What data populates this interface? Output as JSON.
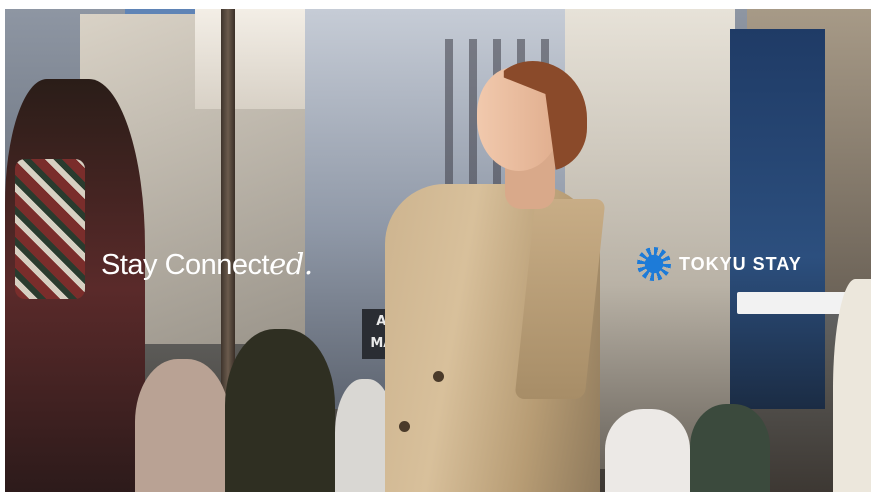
{
  "ad": {
    "tagline_main": "Stay Connect",
    "tagline_suffix": "ed.",
    "brand_name": "TOKYU STAY",
    "brand_color": "#1d7bd8",
    "store_sign": "ABC MART"
  }
}
